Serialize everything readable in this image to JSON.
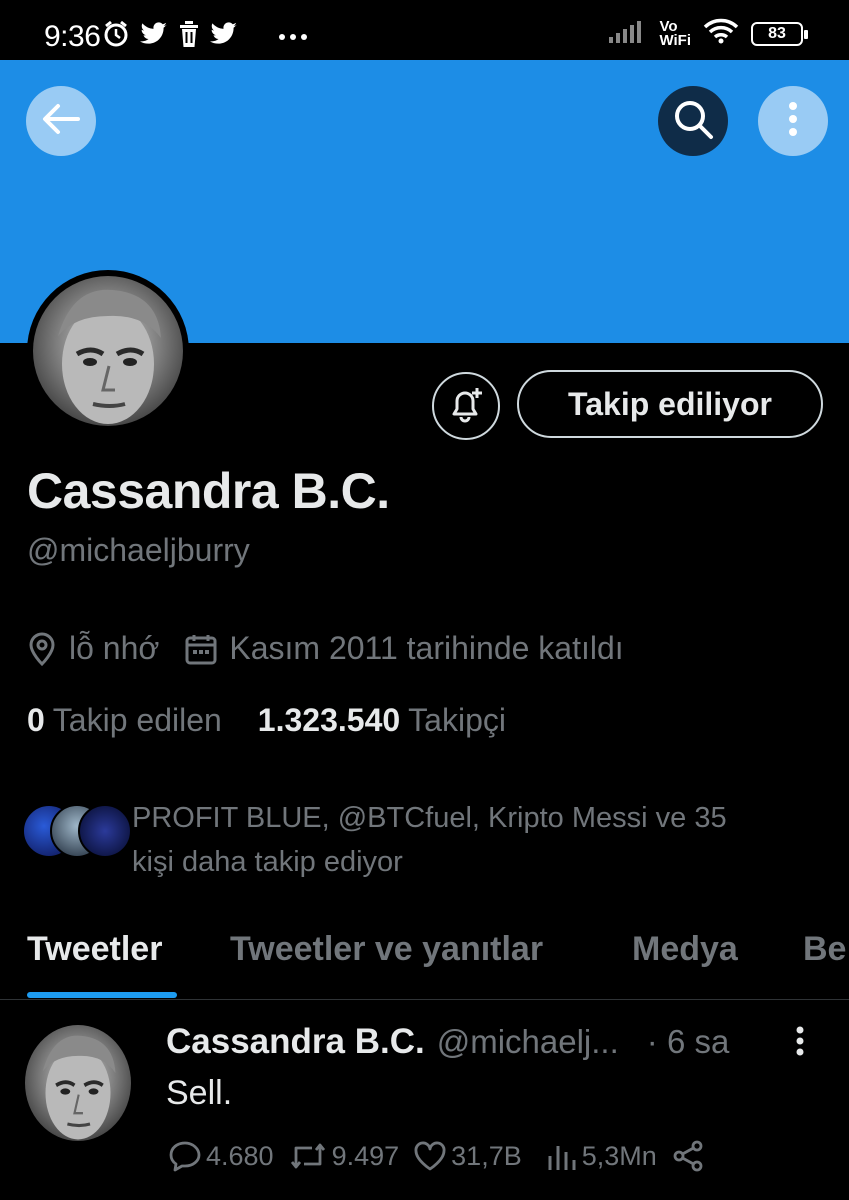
{
  "status_bar": {
    "time": "9:36",
    "network_label_top": "Vo",
    "network_label_bottom": "WiFi",
    "battery": "83",
    "icons": [
      "alarm-icon",
      "twitter-icon",
      "trash-icon",
      "twitter-icon",
      "more-dots-icon",
      "signal-icon",
      "wifi-icon",
      "battery-icon"
    ]
  },
  "header": {
    "banner_color": "#1d8de6",
    "back_icon": "arrow-left-icon",
    "search_icon": "search-icon",
    "more_icon": "more-vertical-icon"
  },
  "profile": {
    "display_name": "Cassandra B.C.",
    "handle": "@michaeljburry",
    "location": "lỗ nhớ",
    "joined": "Kasım 2011 tarihinde katıldı",
    "following_count": "0",
    "following_label": "Takip edilen",
    "followers_count": "1.323.540",
    "followers_label": "Takipçi",
    "followed_by_line1": "PROFIT BLUE, @BTCfuel, Kripto Messi ve 35",
    "followed_by_line2": "kişi daha takip ediyor",
    "follow_button": "Takip ediliyor",
    "notify_icon": "bell-plus-icon"
  },
  "tabs": [
    {
      "label": "Tweetler",
      "active": true
    },
    {
      "label": "Tweetler ve yanıtlar",
      "active": false
    },
    {
      "label": "Medya",
      "active": false
    },
    {
      "label": "Be",
      "active": false
    }
  ],
  "tweet": {
    "name": "Cassandra B.C.",
    "handle": "@michaelj...",
    "time": "· 6 sa",
    "text": "Sell.",
    "replies": "4.680",
    "retweets": "9.497",
    "likes": "31,7B",
    "views": "5,3Mn"
  },
  "colors": {
    "accent": "#1d9bf0",
    "background": "#000000",
    "muted_text": "#71767b"
  }
}
